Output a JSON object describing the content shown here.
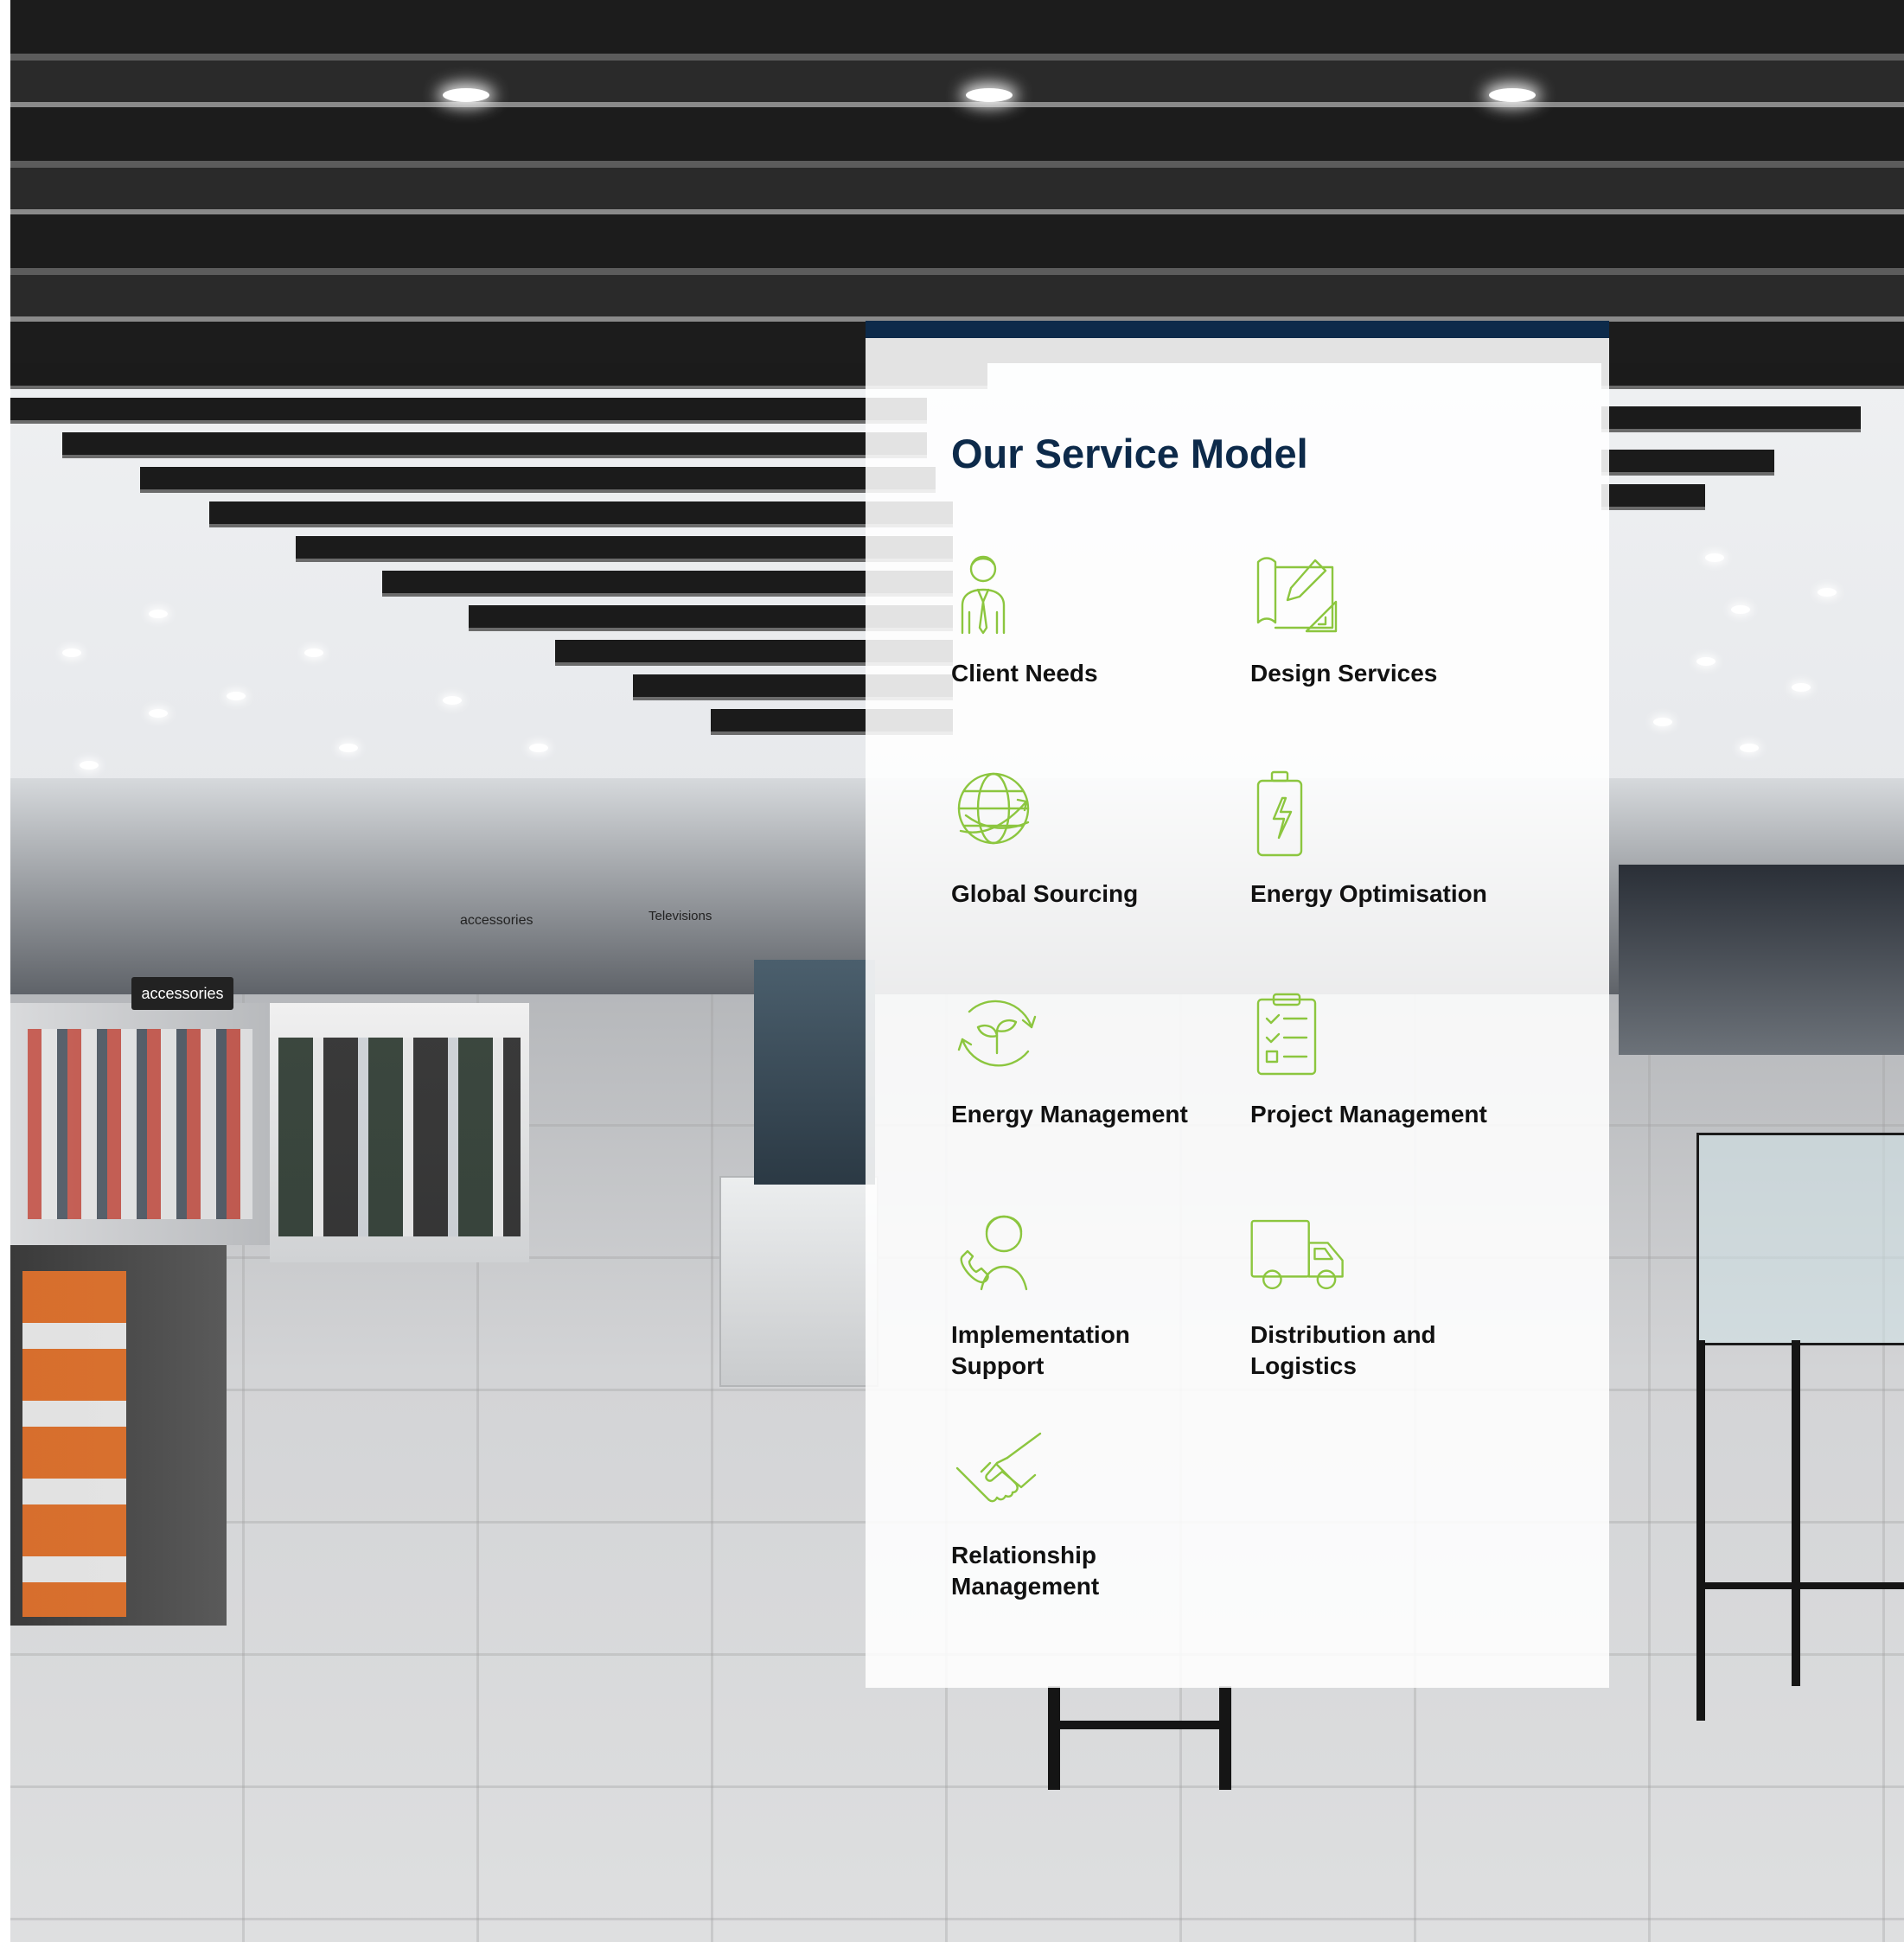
{
  "background": {
    "scene": "electronics retail store interior",
    "signs": [
      "accessories",
      "accessories",
      "Televisions"
    ]
  },
  "panel": {
    "title": "Our Service Model",
    "accent_color": "#0d2a4a",
    "icon_color": "#8cc63f",
    "services": [
      {
        "label": "Client Needs",
        "icon": "businessman-icon"
      },
      {
        "label": "Design Services",
        "icon": "blueprint-pencil-icon"
      },
      {
        "label": "Global Sourcing",
        "icon": "globe-arrows-icon"
      },
      {
        "label": "Energy Optimisation",
        "icon": "battery-bolt-icon"
      },
      {
        "label": "Energy Management",
        "icon": "recycle-plant-icon"
      },
      {
        "label": "Project Management",
        "icon": "clipboard-checklist-icon"
      },
      {
        "label": "Implementation\nSupport",
        "icon": "support-agent-icon"
      },
      {
        "label": "Distribution and\nLogistics",
        "icon": "delivery-truck-icon"
      },
      {
        "label": "Relationship\nManagement",
        "icon": "handshake-icon"
      }
    ]
  }
}
